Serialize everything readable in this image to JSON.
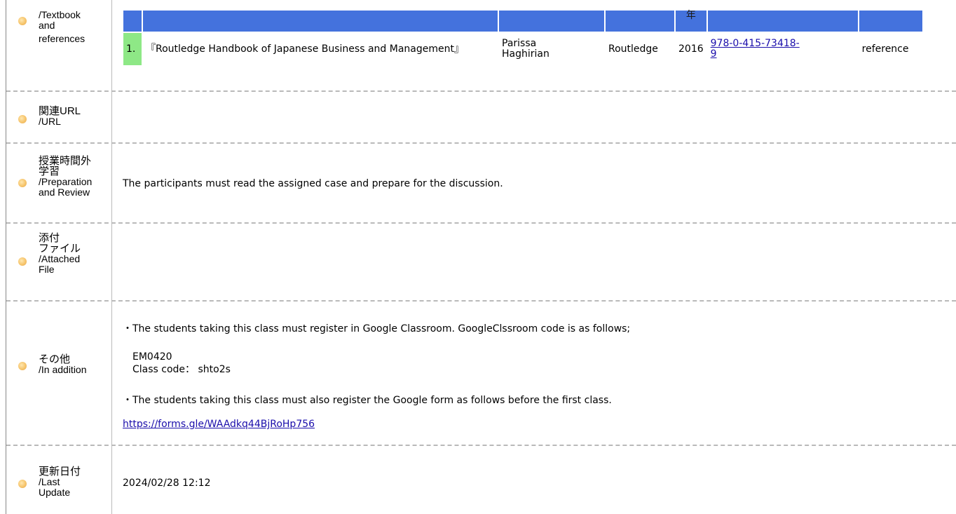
{
  "sections": {
    "textbook": {
      "label_lines": [
        "/Textbook",
        "and",
        "references"
      ]
    },
    "related_url": {
      "label_ja": "関連URL",
      "label_en": "/URL"
    },
    "preparation": {
      "label_ja_1": "授業時間外",
      "label_ja_2": "学習",
      "label_en_1": "/Preparation",
      "label_en_2": "and Review",
      "text": "The participants must read the assigned case and prepare for the discussion."
    },
    "attached": {
      "label_ja_1": "添付",
      "label_ja_2": "ファイル",
      "label_en_1": "/Attached",
      "label_en_2": "File"
    },
    "other": {
      "label_ja": "その他",
      "label_en": "/In addition",
      "line1": "・The students taking this class must register in Google Classroom. GoogleClssroom code is as follows;",
      "code_line1": "EM0420",
      "code_line2": "Class code： shto2s",
      "line2": "・The students taking this class must also register the Google form as follows before the first class.",
      "link": "https://forms.gle/WAAdkq44BjRoHp756"
    },
    "updated": {
      "label_ja": "更新日付",
      "label_en_1": "/Last",
      "label_en_2": "Update",
      "value": "2024/02/28 12:12"
    }
  },
  "book_table": {
    "header_year_char": "年",
    "row": {
      "num": "1.",
      "title": "『Routledge Handbook of Japanese Business and Management』",
      "author_1": "Parissa",
      "author_2": "Haghirian",
      "publisher": "Routledge",
      "year": "2016",
      "isbn_1": "978-0-415-73418-",
      "isbn_2": "9",
      "type": "reference"
    }
  },
  "colors": {
    "header_blue": "#4472dd",
    "num_green": "#8ee886",
    "link": "#1a0dab"
  }
}
